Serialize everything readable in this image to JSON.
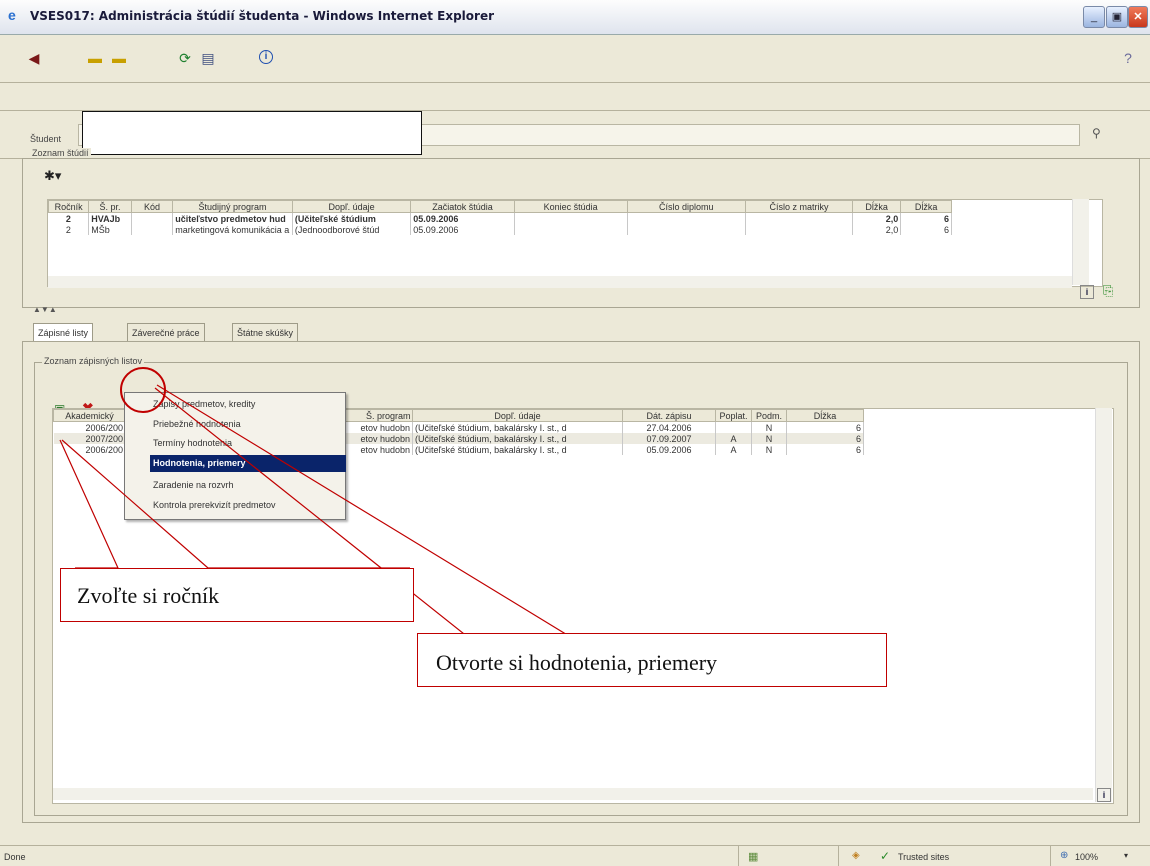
{
  "window": {
    "title": "VSES017: Administrácia štúdií študenta - Windows Internet Explorer",
    "controls": {
      "min": "_",
      "max": "▣",
      "close": "✕"
    }
  },
  "student": {
    "label": "Študent",
    "value": ""
  },
  "studies": {
    "legend": "Zoznam štúdií",
    "columns": [
      "Ročník",
      "Š. pr.",
      "Kód",
      "Študijný program",
      "Dopľ. údaje",
      "Začiatok štúdia",
      "Koniec štúdia",
      "Číslo diplomu",
      "Číslo z matriky",
      "Dĺžka",
      "Dĺžka"
    ],
    "rows": [
      [
        "2",
        "HVAJb",
        "",
        "učiteľstvo predmetov hud",
        "(Učiteľské štúdium",
        "05.09.2006",
        "",
        "",
        "",
        "2,0",
        "6"
      ],
      [
        "2",
        "MŠb",
        "",
        "marketingová komunikácia a c",
        "(Jednoodborové štúd",
        "05.09.2006",
        "",
        "",
        "",
        "2,0",
        "6"
      ]
    ]
  },
  "tabs": [
    "Zápisné listy",
    "Záverečné práce",
    "Štátne skúšky"
  ],
  "enrollment": {
    "legend": "Zoznam zápisných listov",
    "columns": [
      "Akademický",
      "Š. program",
      "Dopľ. údaje",
      "Dát. zápisu",
      "Poplat.",
      "Podm.",
      "Dĺžka"
    ],
    "rows": [
      [
        "2006/200",
        "etov hudobn",
        "(Učiteľské štúdium, bakalársky I. st., d",
        "27.04.2006",
        "",
        "N",
        "6"
      ],
      [
        "2007/200",
        "etov hudobn",
        "(Učiteľské štúdium, bakalársky I. st., d",
        "07.09.2007",
        "A",
        "N",
        "6"
      ],
      [
        "2006/200",
        "etov hudobn",
        "(Učiteľské štúdium, bakalársky I. st., d",
        "05.09.2006",
        "A",
        "N",
        "6"
      ]
    ]
  },
  "context_menu": {
    "items": [
      "Zápisy predmetov, kredity",
      "Priebežné hodnotenia",
      "Termíny hodnotenia",
      "Hodnotenia, priemery",
      "Zaradenie na rozvrh",
      "Kontrola prerekvizít predmetov"
    ],
    "highlighted_index": 3
  },
  "annotations": {
    "select_year": "Zvoľte si ročník",
    "open_grades": "Otvorte si hodnotenia, priemery"
  },
  "statusbar": {
    "left": "Done",
    "zone": "Trusted sites",
    "zoom": "100%"
  }
}
